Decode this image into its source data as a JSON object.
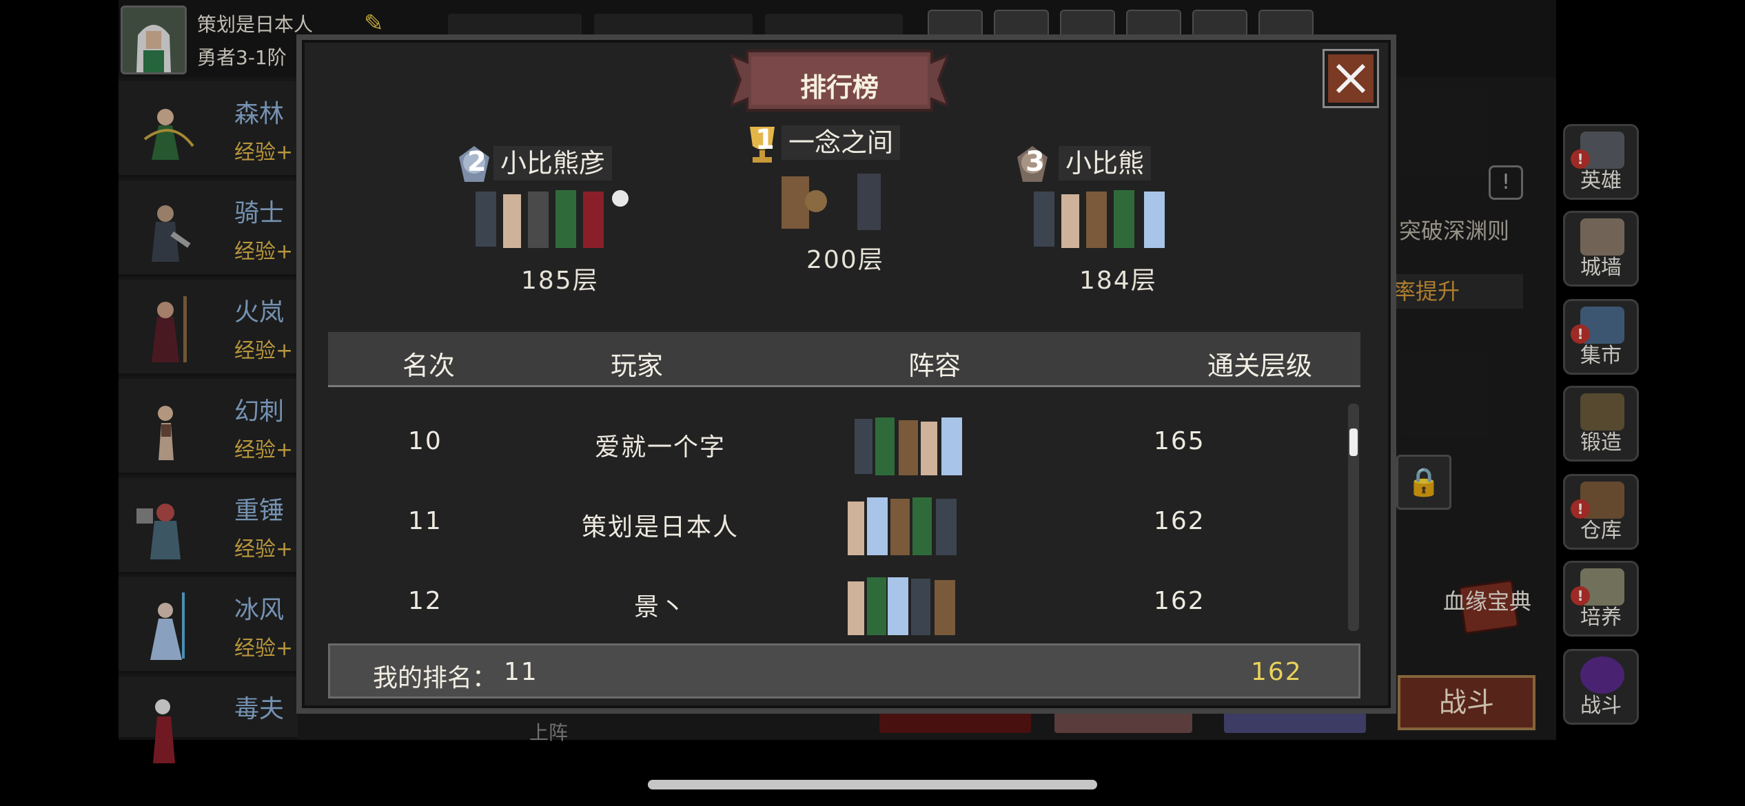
{
  "player": {
    "name": "策划是日本人",
    "rank": "勇者3-1阶"
  },
  "hero_list": [
    {
      "name": "森林",
      "exp": "经验+"
    },
    {
      "name": "骑士",
      "exp": "经验+"
    },
    {
      "name": "火岚",
      "exp": "经验+"
    },
    {
      "name": "幻刺",
      "exp": "经验+"
    },
    {
      "name": "重锤",
      "exp": "经验+"
    },
    {
      "name": "冰风",
      "exp": "经验+"
    },
    {
      "name": "毒夫",
      "exp": ""
    }
  ],
  "side_menu": [
    {
      "label": "英雄",
      "alert": true,
      "icon": "helmet-icon"
    },
    {
      "label": "城墙",
      "alert": false,
      "icon": "castle-wall-icon"
    },
    {
      "label": "集市",
      "alert": true,
      "icon": "market-icon"
    },
    {
      "label": "锻造",
      "alert": false,
      "icon": "anvil-icon"
    },
    {
      "label": "仓库",
      "alert": true,
      "icon": "chest-icon"
    },
    {
      "label": "培养",
      "alert": true,
      "icon": "goblet-icon"
    },
    {
      "label": "战斗",
      "alert": false,
      "icon": "portal-icon"
    }
  ],
  "background_panel": {
    "breakthrough_text": "突破深渊则",
    "rate_text": "率提升",
    "book_label": "血缘宝典",
    "fight_label": "战斗",
    "upper_label": "上阵"
  },
  "dialog": {
    "title": "排行榜",
    "podium": [
      {
        "place": "1",
        "name": "一念之间",
        "floor": "200层"
      },
      {
        "place": "2",
        "name": "小比熊彦",
        "floor": "185层"
      },
      {
        "place": "3",
        "name": "小比熊",
        "floor": "184层"
      }
    ],
    "columns": {
      "rank": "名次",
      "player": "玩家",
      "lineup": "阵容",
      "floor": "通关层级"
    },
    "rows": [
      {
        "rank": "10",
        "player": "爱就一个字",
        "floor": "165"
      },
      {
        "rank": "11",
        "player": "策划是日本人",
        "floor": "162"
      },
      {
        "rank": "12",
        "player": "景丶",
        "floor": "162"
      }
    ],
    "my_rank": {
      "label": "我的排名：",
      "value": "11",
      "floor": "162"
    }
  },
  "colors": {
    "accent_gold": "#e9d25a",
    "hero_name_blue": "#8fb3d9",
    "exp_yellow": "#e0b84a",
    "close_red": "#7a3a24",
    "banner_brown": "#6b4040"
  }
}
